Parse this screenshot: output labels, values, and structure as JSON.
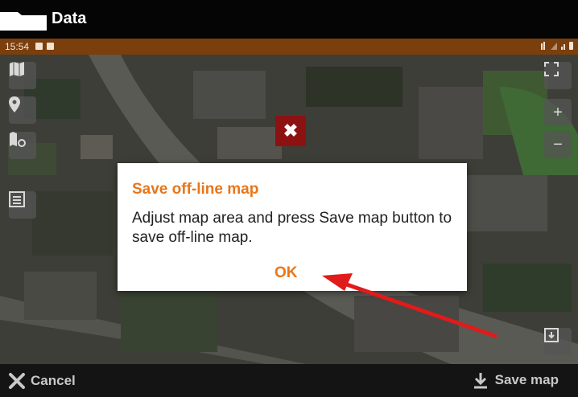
{
  "app": {
    "title": "Data"
  },
  "status": {
    "time": "15:54"
  },
  "map_controls": {
    "left": [
      "map-layers-icon",
      "location-pin-icon",
      "map-settings-icon",
      "list-icon"
    ],
    "right": [
      "fullscreen-icon",
      "zoom-in-icon",
      "zoom-out-icon",
      "map-export-icon"
    ],
    "zoom_in": "+",
    "zoom_out": "−"
  },
  "dialog": {
    "title": "Save off-line map",
    "message": "Adjust map area and press Save map button to save off-line map.",
    "ok": "OK"
  },
  "bottom": {
    "cancel": "Cancel",
    "save": "Save map"
  },
  "colors": {
    "accent": "#e8761a",
    "status_bar": "#7a3f0d",
    "close_red": "#8c1212",
    "arrow_red": "#e01b1b"
  }
}
